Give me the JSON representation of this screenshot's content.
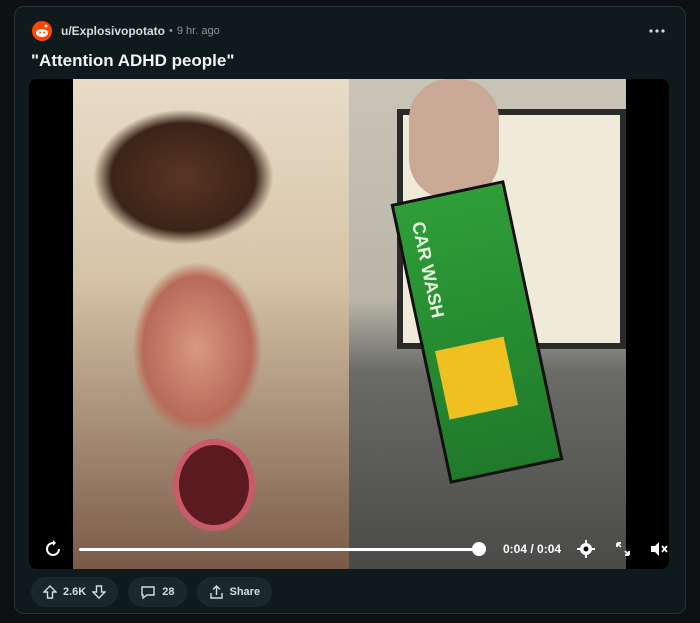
{
  "post": {
    "author": "u/Explosivopotato",
    "separator": "•",
    "time": "9 hr. ago",
    "title": "\"Attention ADHD people\""
  },
  "video": {
    "box_text": "CAR WASH",
    "timecode": "0:04 / 0:04",
    "progress": 1.0
  },
  "actions": {
    "upvotes": "2.6K",
    "comments": "28",
    "share": "Share"
  },
  "icons": [
    "reddit-avatar-icon",
    "more-icon",
    "replay-icon",
    "settings-icon",
    "fullscreen-icon",
    "mute-icon",
    "upvote-icon",
    "downvote-icon",
    "comment-icon",
    "share-icon"
  ]
}
